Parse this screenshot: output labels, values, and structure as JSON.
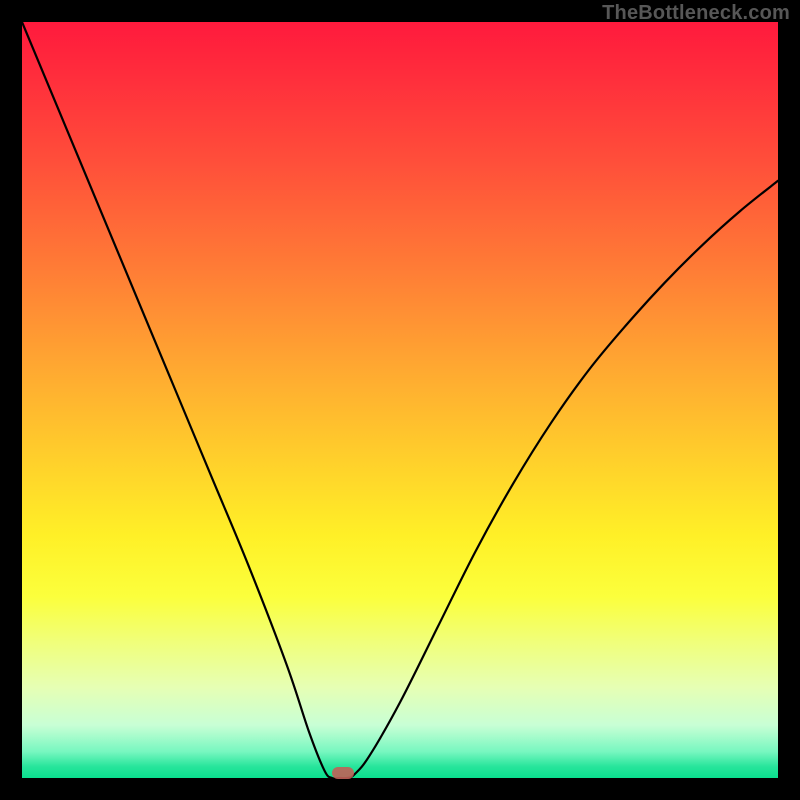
{
  "watermark": "TheBottleneck.com",
  "chart_data": {
    "type": "line",
    "title": "",
    "xlabel": "",
    "ylabel": "",
    "xlim": [
      0,
      100
    ],
    "ylim": [
      0,
      100
    ],
    "grid": false,
    "series": [
      {
        "name": "bottleneck-curve",
        "x": [
          0,
          5,
          10,
          15,
          20,
          25,
          30,
          35,
          38,
          40,
          41,
          42,
          43,
          44,
          46,
          50,
          55,
          60,
          65,
          70,
          75,
          80,
          85,
          90,
          95,
          100
        ],
        "y": [
          100,
          88,
          76,
          64,
          52,
          40,
          28,
          15,
          6,
          1,
          0,
          0,
          0,
          0.5,
          3,
          10,
          20,
          30,
          39,
          47,
          54,
          60,
          65.5,
          70.5,
          75,
          79
        ]
      }
    ],
    "marker": {
      "x": 42.5,
      "y": 0.6
    },
    "gradient_stops": [
      {
        "pct": 0,
        "color": "#ff1a3d"
      },
      {
        "pct": 50,
        "color": "#ffd02b"
      },
      {
        "pct": 80,
        "color": "#fbff3c"
      },
      {
        "pct": 100,
        "color": "#0adf8e"
      }
    ]
  }
}
